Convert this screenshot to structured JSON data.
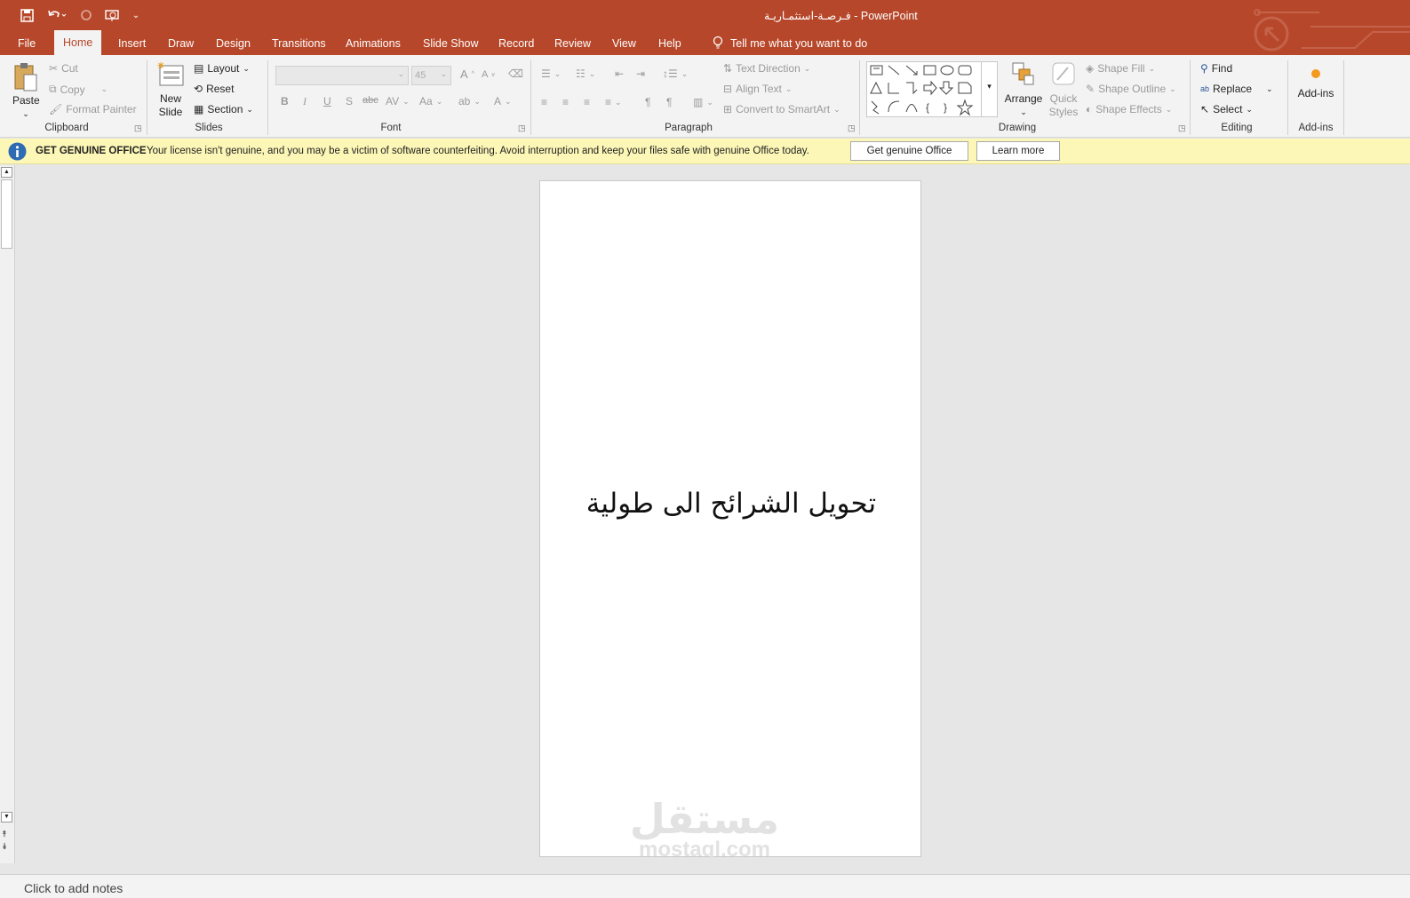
{
  "window": {
    "title": "فـرصـة-استثمـاريـة  -  PowerPoint"
  },
  "quick_access": [
    "save-icon",
    "undo-icon",
    "redo-icon",
    "present-icon",
    "customize-icon"
  ],
  "tabs": [
    "File",
    "Home",
    "Insert",
    "Draw",
    "Design",
    "Transitions",
    "Animations",
    "Slide Show",
    "Record",
    "Review",
    "View",
    "Help"
  ],
  "active_tab": "Home",
  "tell_me": "Tell me what you want to do",
  "ribbon": {
    "clipboard": {
      "label": "Clipboard",
      "paste": "Paste",
      "cut": "Cut",
      "copy": "Copy",
      "format_painter": "Format Painter"
    },
    "slides": {
      "label": "Slides",
      "new_slide_1": "New",
      "new_slide_2": "Slide",
      "layout": "Layout",
      "reset": "Reset",
      "section": "Section"
    },
    "font": {
      "label": "Font",
      "font_size": "45"
    },
    "paragraph": {
      "label": "Paragraph",
      "text_direction": "Text Direction",
      "align_text": "Align Text",
      "convert_smartart": "Convert to SmartArt"
    },
    "drawing": {
      "label": "Drawing",
      "arrange": "Arrange",
      "quick_styles_1": "Quick",
      "quick_styles_2": "Styles",
      "shape_fill": "Shape Fill",
      "shape_outline": "Shape Outline",
      "shape_effects": "Shape Effects"
    },
    "editing": {
      "label": "Editing",
      "find": "Find",
      "replace": "Replace",
      "select": "Select"
    },
    "addins": {
      "label": "Add-ins",
      "button": "Add-ins"
    }
  },
  "genuine_bar": {
    "title": "GET GENUINE OFFICE",
    "message": "Your license isn't genuine, and you may be a victim of software counterfeiting. Avoid interruption and keep your files safe with genuine Office today.",
    "get_button": "Get genuine Office",
    "learn_button": "Learn more"
  },
  "slide": {
    "text": "تحويل الشرائح الى طولية",
    "watermark": "مستقل mostaql.com"
  },
  "notes": {
    "placeholder": "Click to add notes"
  },
  "colors": {
    "accent": "#b7472a",
    "ribbon": "#f3f3f3",
    "genuine_bg": "#fcf7b6"
  }
}
